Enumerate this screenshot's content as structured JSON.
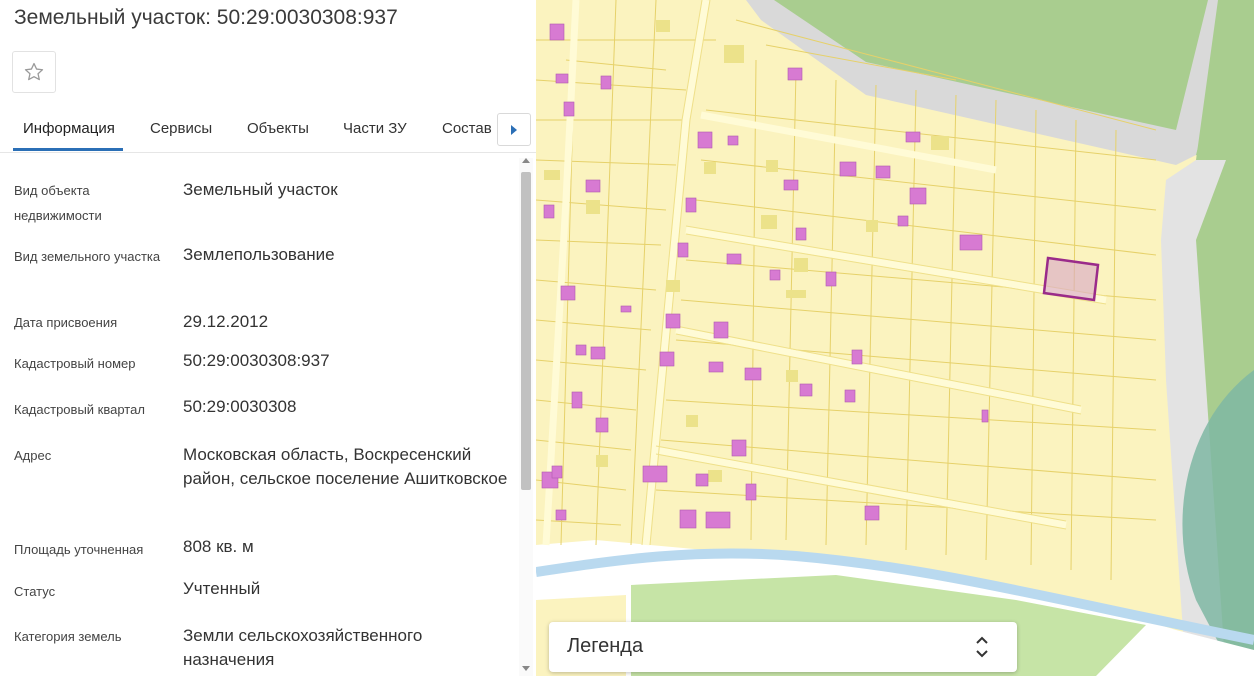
{
  "header": {
    "title": "Земельный участок: 50:29:0030308:937"
  },
  "tabs": [
    {
      "label": "Информация",
      "active": true
    },
    {
      "label": "Сервисы",
      "active": false
    },
    {
      "label": "Объекты",
      "active": false
    },
    {
      "label": "Части ЗУ",
      "active": false
    },
    {
      "label": "Состав",
      "active": false
    }
  ],
  "info": [
    {
      "label": "Вид объекта недвижимости",
      "value": "Земельный участок"
    },
    {
      "label": "Вид земельного участка",
      "value": "Землепользование"
    },
    {
      "label": "Дата присвоения",
      "value": "29.12.2012"
    },
    {
      "label": "Кадастровый номер",
      "value": "50:29:0030308:937"
    },
    {
      "label": "Кадастровый квартал",
      "value": "50:29:0030308"
    },
    {
      "label": "Адрес",
      "value": "Московская область, Воскресенский район, сельское поселение Ашитковское"
    },
    {
      "label": "Площадь уточненная",
      "value": "808 кв. м"
    },
    {
      "label": "Статус",
      "value": "Учтенный"
    },
    {
      "label": "Категория земель",
      "value": "Земли сельскохозяйственного назначения"
    }
  ],
  "legend": {
    "label": "Легенда"
  },
  "icons": {
    "favorite": "star-outline-icon",
    "tab_next": "caret-right-icon",
    "legend_toggle": "chevron-up-down-icon"
  },
  "colors": {
    "accent": "#2b6fb6",
    "map_land": "#fbf3bf",
    "map_road": "#fffbd6",
    "building": "#d77ad2",
    "highlight_parcel": "#9a2b8a",
    "forest": "#a9cd8f",
    "water": "#b9d9ef",
    "road_gray": "#d7d7d7"
  }
}
